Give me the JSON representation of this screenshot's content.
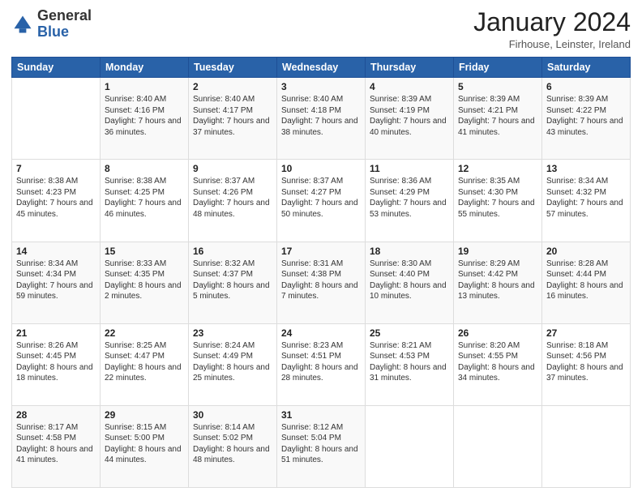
{
  "header": {
    "logo": {
      "general": "General",
      "blue": "Blue"
    },
    "title": "January 2024",
    "subtitle": "Firhouse, Leinster, Ireland"
  },
  "calendar": {
    "days_of_week": [
      "Sunday",
      "Monday",
      "Tuesday",
      "Wednesday",
      "Thursday",
      "Friday",
      "Saturday"
    ],
    "weeks": [
      [
        {
          "day": "",
          "sunrise": "",
          "sunset": "",
          "daylight": ""
        },
        {
          "day": "1",
          "sunrise": "Sunrise: 8:40 AM",
          "sunset": "Sunset: 4:16 PM",
          "daylight": "Daylight: 7 hours and 36 minutes."
        },
        {
          "day": "2",
          "sunrise": "Sunrise: 8:40 AM",
          "sunset": "Sunset: 4:17 PM",
          "daylight": "Daylight: 7 hours and 37 minutes."
        },
        {
          "day": "3",
          "sunrise": "Sunrise: 8:40 AM",
          "sunset": "Sunset: 4:18 PM",
          "daylight": "Daylight: 7 hours and 38 minutes."
        },
        {
          "day": "4",
          "sunrise": "Sunrise: 8:39 AM",
          "sunset": "Sunset: 4:19 PM",
          "daylight": "Daylight: 7 hours and 40 minutes."
        },
        {
          "day": "5",
          "sunrise": "Sunrise: 8:39 AM",
          "sunset": "Sunset: 4:21 PM",
          "daylight": "Daylight: 7 hours and 41 minutes."
        },
        {
          "day": "6",
          "sunrise": "Sunrise: 8:39 AM",
          "sunset": "Sunset: 4:22 PM",
          "daylight": "Daylight: 7 hours and 43 minutes."
        }
      ],
      [
        {
          "day": "7",
          "sunrise": "Sunrise: 8:38 AM",
          "sunset": "Sunset: 4:23 PM",
          "daylight": "Daylight: 7 hours and 45 minutes."
        },
        {
          "day": "8",
          "sunrise": "Sunrise: 8:38 AM",
          "sunset": "Sunset: 4:25 PM",
          "daylight": "Daylight: 7 hours and 46 minutes."
        },
        {
          "day": "9",
          "sunrise": "Sunrise: 8:37 AM",
          "sunset": "Sunset: 4:26 PM",
          "daylight": "Daylight: 7 hours and 48 minutes."
        },
        {
          "day": "10",
          "sunrise": "Sunrise: 8:37 AM",
          "sunset": "Sunset: 4:27 PM",
          "daylight": "Daylight: 7 hours and 50 minutes."
        },
        {
          "day": "11",
          "sunrise": "Sunrise: 8:36 AM",
          "sunset": "Sunset: 4:29 PM",
          "daylight": "Daylight: 7 hours and 53 minutes."
        },
        {
          "day": "12",
          "sunrise": "Sunrise: 8:35 AM",
          "sunset": "Sunset: 4:30 PM",
          "daylight": "Daylight: 7 hours and 55 minutes."
        },
        {
          "day": "13",
          "sunrise": "Sunrise: 8:34 AM",
          "sunset": "Sunset: 4:32 PM",
          "daylight": "Daylight: 7 hours and 57 minutes."
        }
      ],
      [
        {
          "day": "14",
          "sunrise": "Sunrise: 8:34 AM",
          "sunset": "Sunset: 4:34 PM",
          "daylight": "Daylight: 7 hours and 59 minutes."
        },
        {
          "day": "15",
          "sunrise": "Sunrise: 8:33 AM",
          "sunset": "Sunset: 4:35 PM",
          "daylight": "Daylight: 8 hours and 2 minutes."
        },
        {
          "day": "16",
          "sunrise": "Sunrise: 8:32 AM",
          "sunset": "Sunset: 4:37 PM",
          "daylight": "Daylight: 8 hours and 5 minutes."
        },
        {
          "day": "17",
          "sunrise": "Sunrise: 8:31 AM",
          "sunset": "Sunset: 4:38 PM",
          "daylight": "Daylight: 8 hours and 7 minutes."
        },
        {
          "day": "18",
          "sunrise": "Sunrise: 8:30 AM",
          "sunset": "Sunset: 4:40 PM",
          "daylight": "Daylight: 8 hours and 10 minutes."
        },
        {
          "day": "19",
          "sunrise": "Sunrise: 8:29 AM",
          "sunset": "Sunset: 4:42 PM",
          "daylight": "Daylight: 8 hours and 13 minutes."
        },
        {
          "day": "20",
          "sunrise": "Sunrise: 8:28 AM",
          "sunset": "Sunset: 4:44 PM",
          "daylight": "Daylight: 8 hours and 16 minutes."
        }
      ],
      [
        {
          "day": "21",
          "sunrise": "Sunrise: 8:26 AM",
          "sunset": "Sunset: 4:45 PM",
          "daylight": "Daylight: 8 hours and 18 minutes."
        },
        {
          "day": "22",
          "sunrise": "Sunrise: 8:25 AM",
          "sunset": "Sunset: 4:47 PM",
          "daylight": "Daylight: 8 hours and 22 minutes."
        },
        {
          "day": "23",
          "sunrise": "Sunrise: 8:24 AM",
          "sunset": "Sunset: 4:49 PM",
          "daylight": "Daylight: 8 hours and 25 minutes."
        },
        {
          "day": "24",
          "sunrise": "Sunrise: 8:23 AM",
          "sunset": "Sunset: 4:51 PM",
          "daylight": "Daylight: 8 hours and 28 minutes."
        },
        {
          "day": "25",
          "sunrise": "Sunrise: 8:21 AM",
          "sunset": "Sunset: 4:53 PM",
          "daylight": "Daylight: 8 hours and 31 minutes."
        },
        {
          "day": "26",
          "sunrise": "Sunrise: 8:20 AM",
          "sunset": "Sunset: 4:55 PM",
          "daylight": "Daylight: 8 hours and 34 minutes."
        },
        {
          "day": "27",
          "sunrise": "Sunrise: 8:18 AM",
          "sunset": "Sunset: 4:56 PM",
          "daylight": "Daylight: 8 hours and 37 minutes."
        }
      ],
      [
        {
          "day": "28",
          "sunrise": "Sunrise: 8:17 AM",
          "sunset": "Sunset: 4:58 PM",
          "daylight": "Daylight: 8 hours and 41 minutes."
        },
        {
          "day": "29",
          "sunrise": "Sunrise: 8:15 AM",
          "sunset": "Sunset: 5:00 PM",
          "daylight": "Daylight: 8 hours and 44 minutes."
        },
        {
          "day": "30",
          "sunrise": "Sunrise: 8:14 AM",
          "sunset": "Sunset: 5:02 PM",
          "daylight": "Daylight: 8 hours and 48 minutes."
        },
        {
          "day": "31",
          "sunrise": "Sunrise: 8:12 AM",
          "sunset": "Sunset: 5:04 PM",
          "daylight": "Daylight: 8 hours and 51 minutes."
        },
        {
          "day": "",
          "sunrise": "",
          "sunset": "",
          "daylight": ""
        },
        {
          "day": "",
          "sunrise": "",
          "sunset": "",
          "daylight": ""
        },
        {
          "day": "",
          "sunrise": "",
          "sunset": "",
          "daylight": ""
        }
      ]
    ]
  }
}
